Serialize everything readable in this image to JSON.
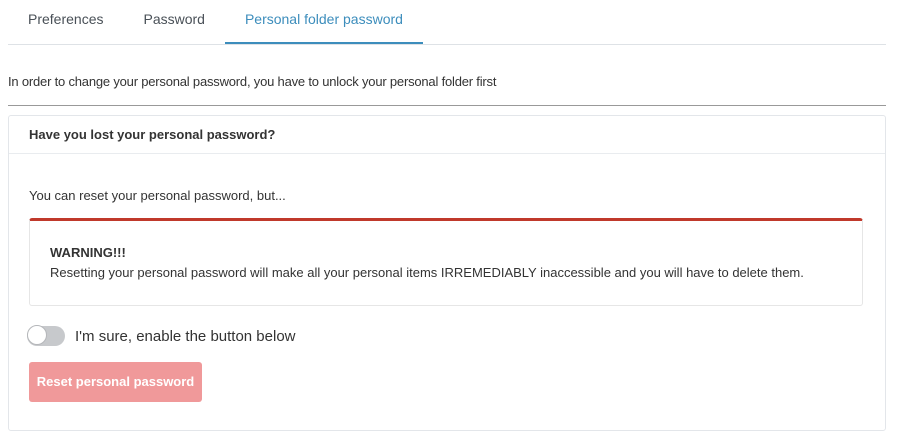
{
  "tabs": [
    {
      "label": "Preferences",
      "active": false
    },
    {
      "label": "Password",
      "active": false
    },
    {
      "label": "Personal folder password",
      "active": true
    }
  ],
  "intro_text": "In order to change your personal password, you have to unlock your personal folder first",
  "card": {
    "title": "Have you lost your personal password?",
    "text": "You can reset your personal password, but...",
    "warning": {
      "title": "WARNING!!!",
      "body": "Resetting your personal password will make all your personal items IRREMEDIABLY inaccessible and you will have to delete them."
    },
    "toggle": {
      "label": "I'm sure, enable the button below",
      "checked": false
    },
    "reset_button": {
      "label": "Reset personal password",
      "enabled": false
    }
  },
  "colors": {
    "active_tab": "#3c8dbc",
    "warning_border": "#c0392b",
    "reset_button_disabled": "#f0999a"
  }
}
